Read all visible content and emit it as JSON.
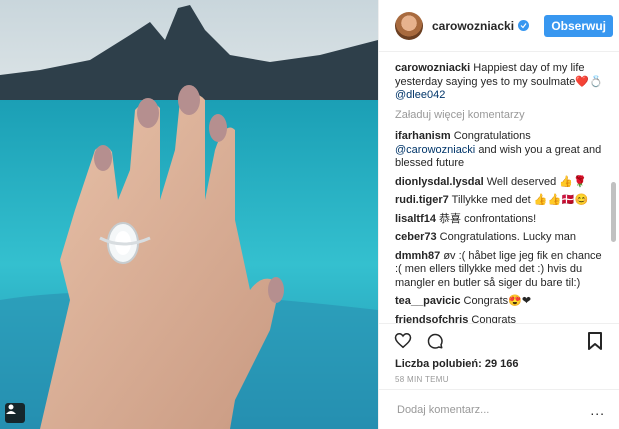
{
  "post": {
    "username": "carowozniacki",
    "follow_label": "Obserwuj",
    "caption_user": "carowozniacki",
    "caption_text": "Happiest day of my life yesterday saying yes to my soulmate❤️💍",
    "caption_mention": "@dlee042",
    "load_more": "Załaduj więcej komentarzy",
    "likes": "Liczba polubień: 29 166",
    "time": "58 MIN TEMU",
    "add_comment_placeholder": "Dodaj komentarz...",
    "more_options": "..."
  },
  "comments": [
    {
      "user": "ifarhanism",
      "pre": "Congratulations",
      "mention": "@carowozniacki",
      "post": "and wish you a great and blessed future"
    },
    {
      "user": "dionlysdal.lysdal",
      "text": "Well deserved 👍🌹"
    },
    {
      "user": "rudi.tiger7",
      "text": "Tillykke med det 👍👍🇩🇰😊"
    },
    {
      "user": "lisaltf14",
      "text": "恭喜 confrontations!"
    },
    {
      "user": "ceber73",
      "text": "Congratulations. Lucky man"
    },
    {
      "user": "dmmh87",
      "text": "øv :( håbet lige jeg fik en chance :( men ellers tillykke med det :) hvis du mangler en butler så siger du bare til:)"
    },
    {
      "user": "tea__pavicic",
      "text": "Congrats😍❤"
    },
    {
      "user": "friendsofchris",
      "text": "Congrats"
    }
  ],
  "icons": {
    "verified": "verified-badge-icon",
    "like": "heart-icon",
    "comment": "comment-bubble-icon",
    "save": "bookmark-icon",
    "tag": "user-tag-icon"
  },
  "colors": {
    "accent": "#3897f0",
    "mention": "#003569",
    "muted": "#999999",
    "sea": "#2bb0c0"
  }
}
